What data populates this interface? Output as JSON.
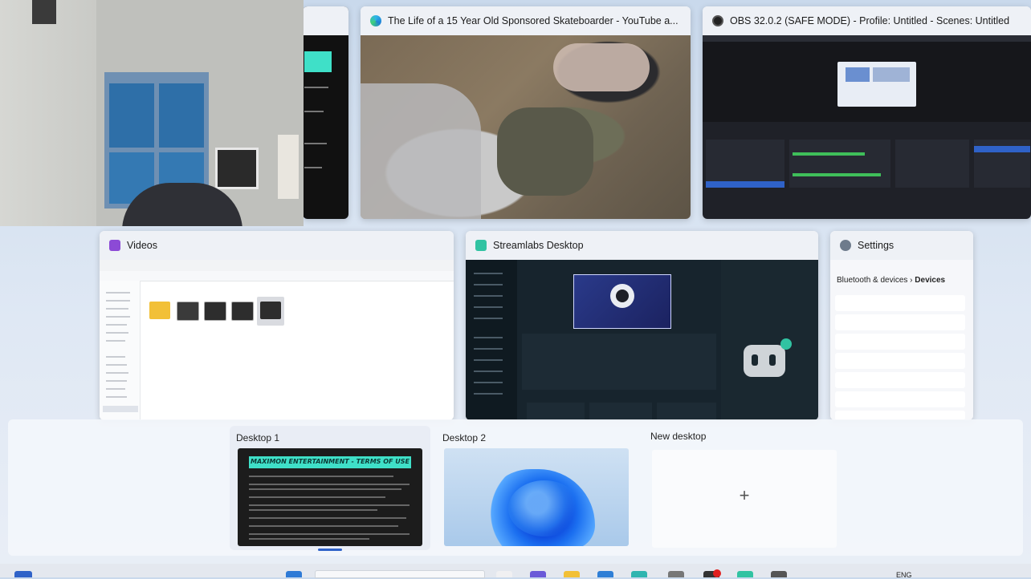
{
  "windows": [
    {
      "title": "The Life of a 15 Year Old Sponsored Skateboarder - YouTube a...",
      "app": "edge"
    },
    {
      "title": "OBS 32.0.2 (SAFE MODE) - Profile: Untitled - Scenes: Untitled",
      "app": "obs"
    },
    {
      "title": "Videos",
      "app": "file-explorer"
    },
    {
      "title": "Streamlabs Desktop",
      "app": "streamlabs"
    },
    {
      "title": "Settings",
      "app": "settings"
    }
  ],
  "settings_preview": {
    "breadcrumb_parent": "Bluetooth & devices",
    "breadcrumb_sep": "›",
    "breadcrumb_current": "Devices"
  },
  "desktops": [
    {
      "label": "Desktop 1",
      "active": true
    },
    {
      "label": "Desktop 2",
      "active": false
    },
    {
      "label": "New desktop",
      "plus": "+"
    }
  ],
  "desktop1_thumb": {
    "banner": "MAXIMON ENTERTAINMENT - TERMS OF USE"
  },
  "taskbar": {
    "lang": "ENG"
  },
  "colors": {
    "accent": "#2f62c8",
    "teal": "#3fe0c8",
    "obs_bg": "#1f2128"
  }
}
